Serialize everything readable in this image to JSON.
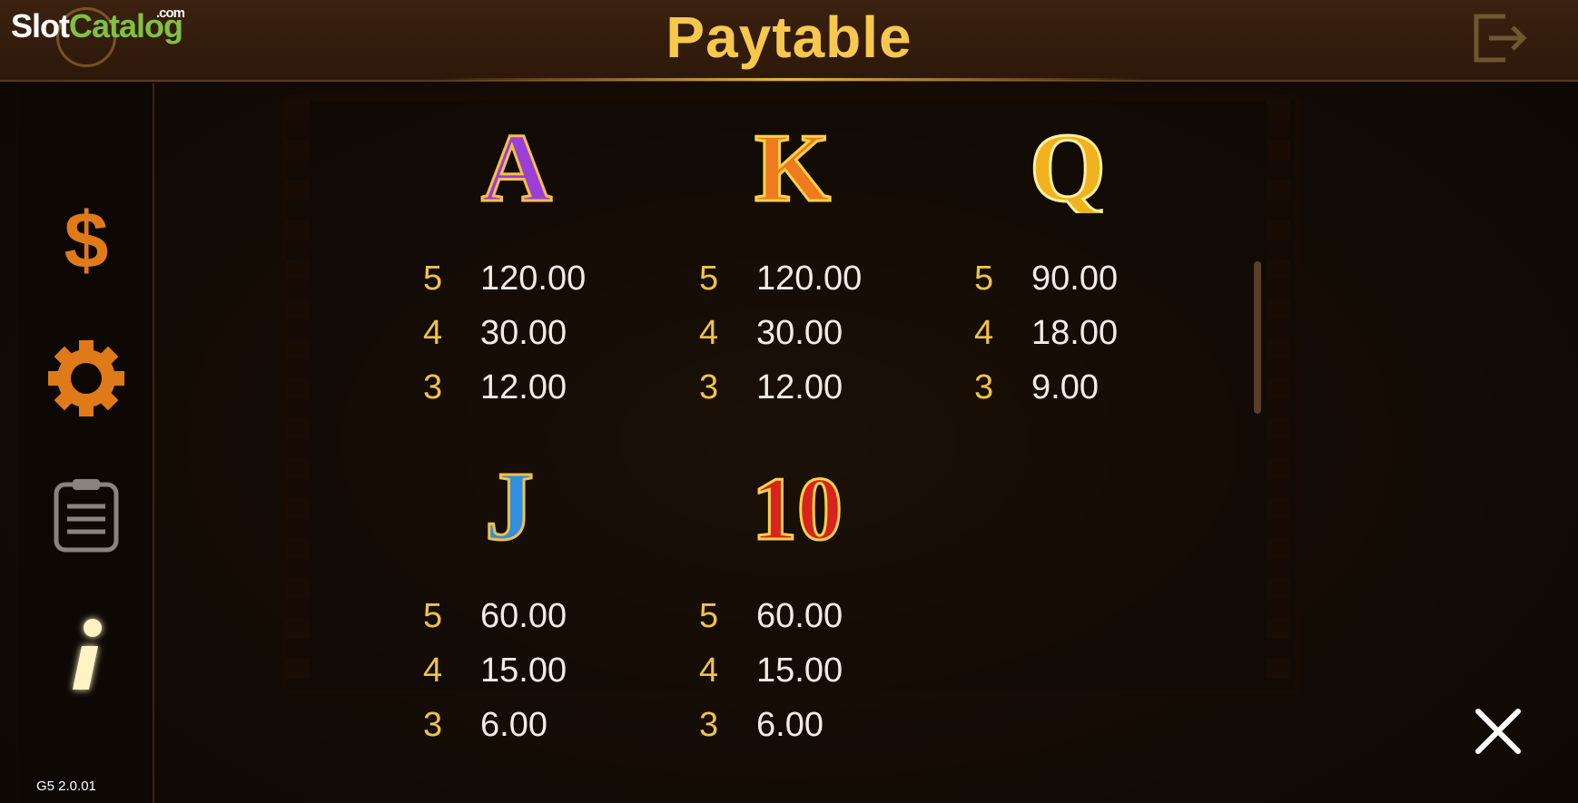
{
  "header": {
    "title": "Paytable"
  },
  "logo": {
    "brand_part1": "Slot",
    "brand_part2": "Catalog",
    "brand_suffix": ".com"
  },
  "sidebar": {
    "items": [
      {
        "name": "bet",
        "icon": "dollar-icon"
      },
      {
        "name": "settings",
        "icon": "gear-icon"
      },
      {
        "name": "history",
        "icon": "clipboard-icon"
      },
      {
        "name": "info",
        "icon": "info-icon"
      }
    ],
    "version": "G5 2.0.01"
  },
  "symbols": [
    {
      "letter": "A",
      "color": "#9b3fd6",
      "payouts": [
        {
          "count": "5",
          "value": "120.00"
        },
        {
          "count": "4",
          "value": "30.00"
        },
        {
          "count": "3",
          "value": "12.00"
        }
      ]
    },
    {
      "letter": "K",
      "color": "#f07a1e",
      "payouts": [
        {
          "count": "5",
          "value": "120.00"
        },
        {
          "count": "4",
          "value": "30.00"
        },
        {
          "count": "3",
          "value": "12.00"
        }
      ]
    },
    {
      "letter": "Q",
      "color": "#f2b21e",
      "payouts": [
        {
          "count": "5",
          "value": "90.00"
        },
        {
          "count": "4",
          "value": "18.00"
        },
        {
          "count": "3",
          "value": "9.00"
        }
      ]
    },
    {
      "letter": "J",
      "color": "#2f8fe0",
      "payouts": [
        {
          "count": "5",
          "value": "60.00"
        },
        {
          "count": "4",
          "value": "15.00"
        },
        {
          "count": "3",
          "value": "6.00"
        }
      ]
    },
    {
      "letter": "10",
      "color": "#d8231f",
      "payouts": [
        {
          "count": "5",
          "value": "60.00"
        },
        {
          "count": "4",
          "value": "15.00"
        },
        {
          "count": "3",
          "value": "6.00"
        }
      ]
    }
  ],
  "colors": {
    "accent": "#f6c84e",
    "sidebar_icon": "#e07a18"
  }
}
